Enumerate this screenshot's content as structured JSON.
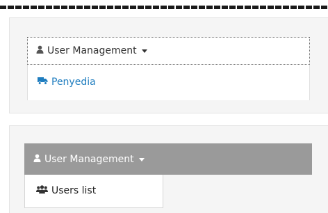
{
  "panel_top": {
    "dropdown_label": "User Management",
    "menu_item_label": "Penyedia"
  },
  "panel_bottom": {
    "dropdown_label": "User Management",
    "menu_item_label": "Users list"
  },
  "icons": {
    "user": "user-icon",
    "truck": "truck-icon",
    "users": "users-icon",
    "caret": "caret-down-icon"
  },
  "colors": {
    "link": "#1f7dbf",
    "active_bar": "#9a9a9a"
  }
}
